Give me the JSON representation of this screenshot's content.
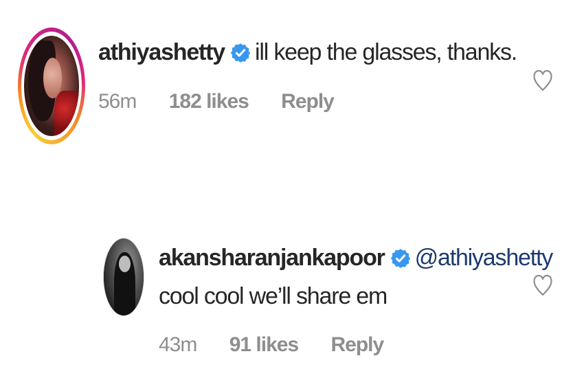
{
  "comments": [
    {
      "username": "athiyashetty",
      "text": "ill keep the glasses, thanks.",
      "time": "56m",
      "likes": "182 likes",
      "reply": "Reply",
      "verified": true,
      "has_story_ring": true
    },
    {
      "username": "akansharanjankapoor",
      "mention": "@athiyashetty",
      "text": "cool cool we’ll share em",
      "time": "43m",
      "likes": "91 likes",
      "reply": "Reply",
      "verified": true,
      "has_story_ring": false
    }
  ],
  "icons": {
    "verified": "verified-badge-icon",
    "like": "heart-outline-icon"
  },
  "colors": {
    "verified_blue": "#3897f0",
    "meta_gray": "#8e8e8e",
    "mention_blue": "#1e3a6e",
    "text": "#262626"
  }
}
